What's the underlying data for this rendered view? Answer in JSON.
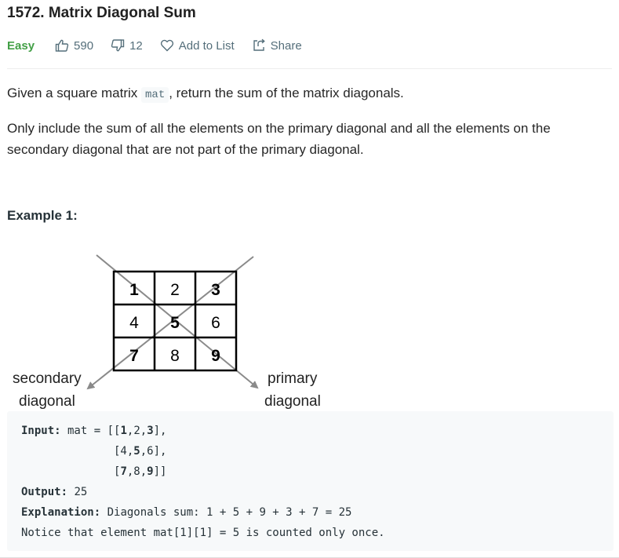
{
  "problem": {
    "title": "1572. Matrix Diagonal Sum",
    "difficulty": "Easy",
    "likes": "590",
    "dislikes": "12",
    "add_to_list": "Add to List",
    "share": "Share"
  },
  "description": {
    "p1_before": "Given a square matrix ",
    "p1_code": "mat",
    "p1_after": ", return the sum of the matrix diagonals.",
    "p2": "Only include the sum of all the elements on the primary diagonal and all the elements on the secondary diagonal that are not part of the primary diagonal."
  },
  "example": {
    "title": "Example 1:",
    "matrix": [
      [
        "1",
        "2",
        "3"
      ],
      [
        "4",
        "5",
        "6"
      ],
      [
        "7",
        "8",
        "9"
      ]
    ],
    "secondary_label_1": "secondary",
    "secondary_label_2": "diagonal",
    "primary_label_1": "primary",
    "primary_label_2": "diagonal",
    "input_label": "Input:",
    "input_var": " mat = ",
    "output_label": "Output:",
    "output_value": " 25",
    "explanation_label": "Explanation:",
    "explanation_text": " Diagonals sum: 1 + 5 + 9 + 3 + 7 = 25",
    "notice": "Notice that element mat[1][1] = 5 is counted only once."
  }
}
